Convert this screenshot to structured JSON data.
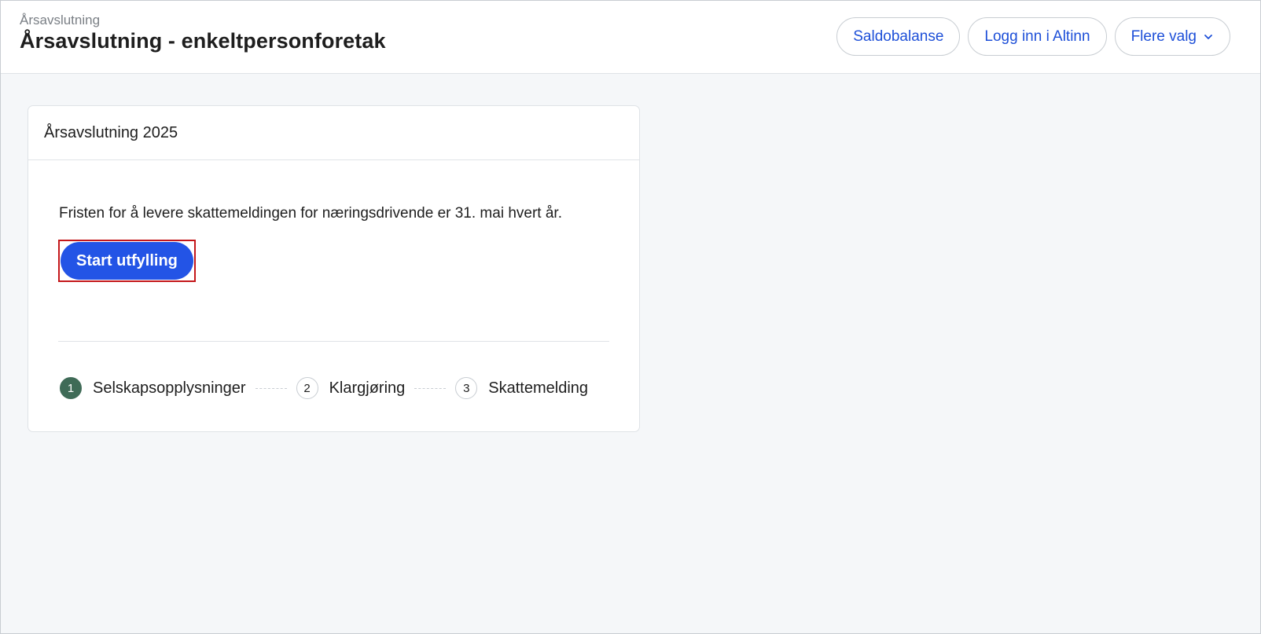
{
  "header": {
    "breadcrumb": "Årsavslutning",
    "title": "Årsavslutning - enkeltpersonforetak",
    "actions": {
      "saldobalanse": "Saldobalanse",
      "altinn": "Logg inn i Altinn",
      "more": "Flere valg"
    }
  },
  "card": {
    "title": "Årsavslutning 2025",
    "deadline": "Fristen for å levere skattemeldingen for næringsdrivende er 31. mai hvert år.",
    "start_button": "Start utfylling",
    "steps": [
      {
        "num": "1",
        "label": "Selskapsopplysninger"
      },
      {
        "num": "2",
        "label": "Klargjøring"
      },
      {
        "num": "3",
        "label": "Skattemelding"
      }
    ]
  },
  "colors": {
    "primary": "#2354e6",
    "link": "#1d4fd8",
    "active_step": "#3f6b57",
    "highlight": "#c4171a"
  }
}
